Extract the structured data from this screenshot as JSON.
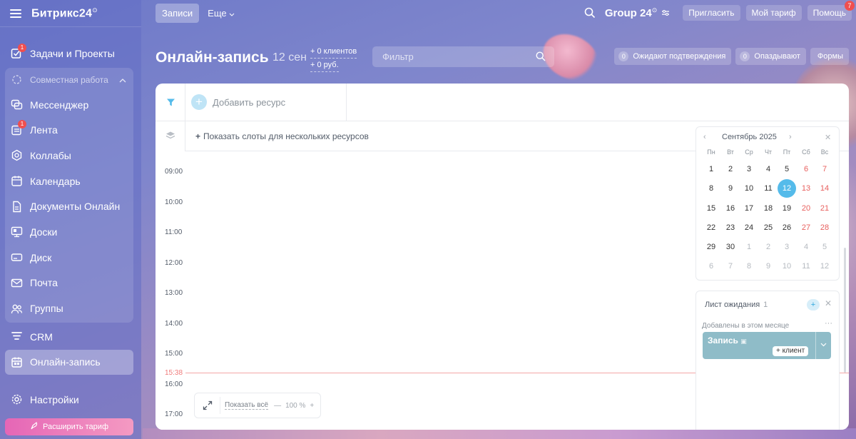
{
  "sidebar": {
    "brand": "Битрикс24",
    "items_top": [
      {
        "label": "Задачи и Проекты",
        "badge": "1",
        "icon": "checkbox-icon"
      }
    ],
    "group": {
      "label": "Совместная работа",
      "items": [
        {
          "label": "Мессенджер",
          "icon": "chat-icon"
        },
        {
          "label": "Лента",
          "badge": "1",
          "icon": "feed-icon"
        },
        {
          "label": "Коллабы",
          "icon": "hexagon-icon"
        },
        {
          "label": "Календарь",
          "icon": "calendar-icon"
        },
        {
          "label": "Документы Онлайн",
          "icon": "document-icon"
        },
        {
          "label": "Доски",
          "icon": "board-icon"
        },
        {
          "label": "Диск",
          "icon": "disk-icon"
        },
        {
          "label": "Почта",
          "icon": "mail-icon"
        },
        {
          "label": "Группы",
          "icon": "groups-icon"
        }
      ]
    },
    "items_bottom": [
      {
        "label": "CRM",
        "icon": "crm-icon"
      },
      {
        "label": "Онлайн-запись",
        "icon": "booking-icon",
        "active": true
      }
    ],
    "settings": "Настройки",
    "upgrade": "Расширить тариф"
  },
  "topbar": {
    "tab_active": "Записи",
    "tab_more": "Еще",
    "group_name": "Group 24",
    "invite": "Пригласить",
    "my_plan": "Мой тариф",
    "help": "Помощь",
    "help_badge": "7"
  },
  "header": {
    "title": "Онлайн-запись",
    "date": "12 сен",
    "clients": "+ 0 клиентов",
    "revenue": "+ 0 руб.",
    "filter_placeholder": "Фильтр",
    "pills": [
      {
        "count": "0",
        "label": "Ожидают подтверждения"
      },
      {
        "count": "0",
        "label": "Опаздывают"
      },
      {
        "count": "",
        "label": "Формы"
      }
    ]
  },
  "schedule": {
    "add_resource": "Добавить ресурс",
    "show_slots": "Показать слоты для нескольких ресурсов",
    "times": [
      "09:00",
      "10:00",
      "11:00",
      "12:00",
      "13:00",
      "14:00",
      "15:00",
      "16:00",
      "17:00"
    ],
    "now": "15:38",
    "show_all": "Показать всё",
    "zoom": "100 %",
    "zoom_minus": "—",
    "zoom_plus": "+"
  },
  "calendar": {
    "month": "Сентябрь 2025",
    "weekdays": [
      "Пн",
      "Вт",
      "Ср",
      "Чт",
      "Пт",
      "Сб",
      "Вс"
    ],
    "weeks": [
      [
        "1",
        "2",
        "3",
        "4",
        "5",
        "6",
        "7"
      ],
      [
        "8",
        "9",
        "10",
        "11",
        "12",
        "13",
        "14"
      ],
      [
        "15",
        "16",
        "17",
        "18",
        "19",
        "20",
        "21"
      ],
      [
        "22",
        "23",
        "24",
        "25",
        "26",
        "27",
        "28"
      ],
      [
        "29",
        "30",
        "1",
        "2",
        "3",
        "4",
        "5"
      ],
      [
        "6",
        "7",
        "8",
        "9",
        "10",
        "11",
        "12"
      ]
    ],
    "today": "12",
    "colors": {
      "today": "#55bbea",
      "weekend": "#e8605e",
      "muted": "#b5bac0"
    }
  },
  "waitlist": {
    "title": "Лист ожидания",
    "count": "1",
    "subtitle": "Добавлены в этом месяце",
    "item_name": "Запись",
    "client_button": "+ клиент"
  }
}
